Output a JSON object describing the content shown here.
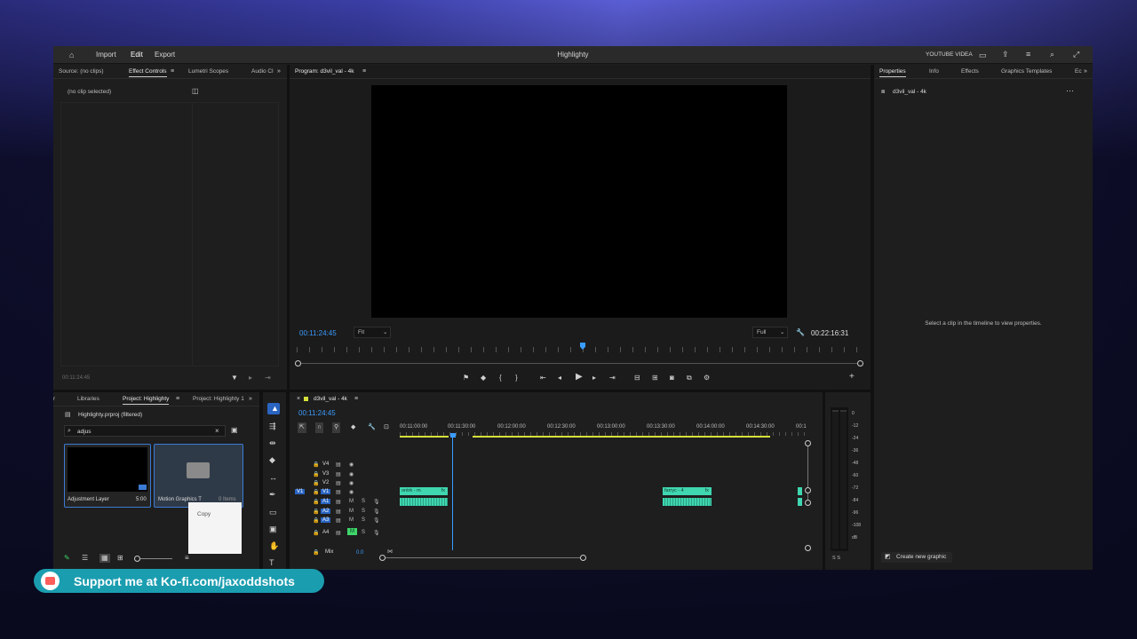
{
  "topbar": {
    "title": "Highlighty",
    "home_label": "Import",
    "edit_label": "Edit",
    "export_label": "Export",
    "workspace": "YOUTUBE VIDEA"
  },
  "source_panel": {
    "tabs": [
      "Source: (no clips)",
      "Effect Controls",
      "Lumetri Scopes",
      "Audio Cl"
    ],
    "no_clip": "(no clip selected)",
    "timecode": "00:11:24:45"
  },
  "program": {
    "tab": "Program: d3vil_val - 4k",
    "timecode_left": "00:11:24:45",
    "fit": "Fit",
    "quality": "Full",
    "timecode_right": "00:22:16:31"
  },
  "properties": {
    "tabs": [
      "Properties",
      "Info",
      "Effects",
      "Graphics Templates",
      "Ec"
    ],
    "sequence": "d3vil_val - 4k",
    "message": "Select a clip in the timeline to view properties.",
    "create_button": "Create new graphic"
  },
  "project": {
    "tabs": [
      "Libraries",
      "Project: Highlighty",
      "Project: Highlighty 1"
    ],
    "file": "Highlighty.prproj (filtered)",
    "search_value": "adjus",
    "items": [
      {
        "name": "Adjustment Layer",
        "duration": "5:00"
      },
      {
        "name": "Motion Graphics T",
        "count": "0 Items"
      }
    ],
    "context_menu": "Copy"
  },
  "timeline": {
    "tab": "d3vil_val - 4k",
    "timecode": "00:11:24:45",
    "ruler": [
      "00:11:00:00",
      "00:11:30:00",
      "00:12:00:00",
      "00:12:30:00",
      "00:13:00:00",
      "00:13:30:00",
      "00:14:00:00",
      "00:14:30:00",
      "00:1"
    ],
    "video_tracks": [
      "V4",
      "V3",
      "V2",
      "V1"
    ],
    "audio_tracks": [
      "A1",
      "A2",
      "A3",
      "A4"
    ],
    "mix_label": "Mix",
    "mix_value": "0.0",
    "clips": [
      "ontrk - m",
      "farryc - 4"
    ]
  },
  "meter": {
    "labels": [
      "0",
      "-12",
      "-24",
      "-36",
      "-48",
      "-60",
      "-72",
      "-84",
      "-96",
      "-108",
      "dB"
    ],
    "solo": "S S"
  },
  "banner": {
    "text": "Support me at Ko-fi.com/jaxoddshots"
  }
}
